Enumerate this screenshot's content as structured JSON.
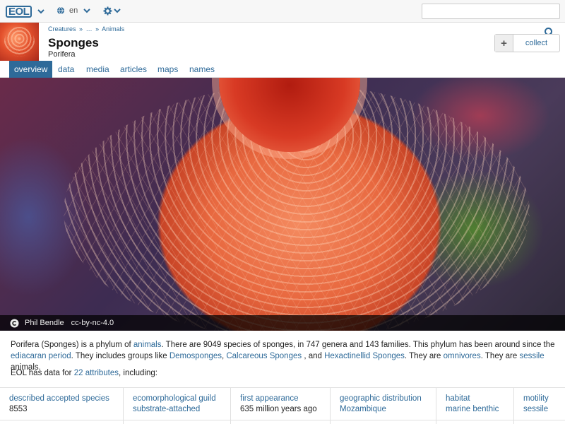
{
  "topbar": {
    "logo": "EOL",
    "language": "en",
    "search_placeholder": ""
  },
  "header": {
    "breadcrumb": [
      "Creatures",
      "»",
      "…",
      "»",
      "Animals"
    ],
    "title": "Sponges",
    "subtitle": "Porifera",
    "collect_plus": "+",
    "collect_label": "collect"
  },
  "tabs": [
    {
      "label": "overview",
      "active": true
    },
    {
      "label": "data"
    },
    {
      "label": "media"
    },
    {
      "label": "articles"
    },
    {
      "label": "maps"
    },
    {
      "label": "names"
    }
  ],
  "hero": {
    "author": "Phil Bendle",
    "license": "cc-by-nc-4.0"
  },
  "summary": {
    "p1": "Porifera (Sponges) is a phylum of ",
    "animals": "animals",
    "p2": ". There are 9049 species of sponges, in 747 genera and 143 families. This phylum has been around since the ",
    "ediacaran": "ediacaran period",
    "p3": ". They includes groups like ",
    "demosponges": "Demosponges",
    "sep1": ", ",
    "calcareous": "Calcareous Sponges",
    "p4": " , and ",
    "hexactinellid": "Hexactinellid Sponges",
    "p5": ". They are ",
    "omnivores": "omnivores",
    "p6": ". They are ",
    "sessile": "sessile",
    "p7": " animals."
  },
  "data_line": {
    "prefix": "EOL has data for ",
    "link": "22 attributes",
    "suffix": ", including:"
  },
  "attributes": [
    {
      "key": "described accepted species",
      "value": "8553",
      "value_is_link": false
    },
    {
      "key": "ecomorphological guild",
      "value": "substrate-attached",
      "value_is_link": true
    },
    {
      "key": "first appearance",
      "value": "635 million years ago",
      "value_is_link": false
    },
    {
      "key": "geographic distribution",
      "value": "Mozambique",
      "value_is_link": true
    },
    {
      "key": "habitat",
      "value": "marine benthic",
      "value_is_link": true
    },
    {
      "key": "motility",
      "value": "sessile",
      "value_is_link": true
    }
  ],
  "colors": {
    "brand": "#2e6a99",
    "tab_active_bg": "#2e6a99"
  }
}
